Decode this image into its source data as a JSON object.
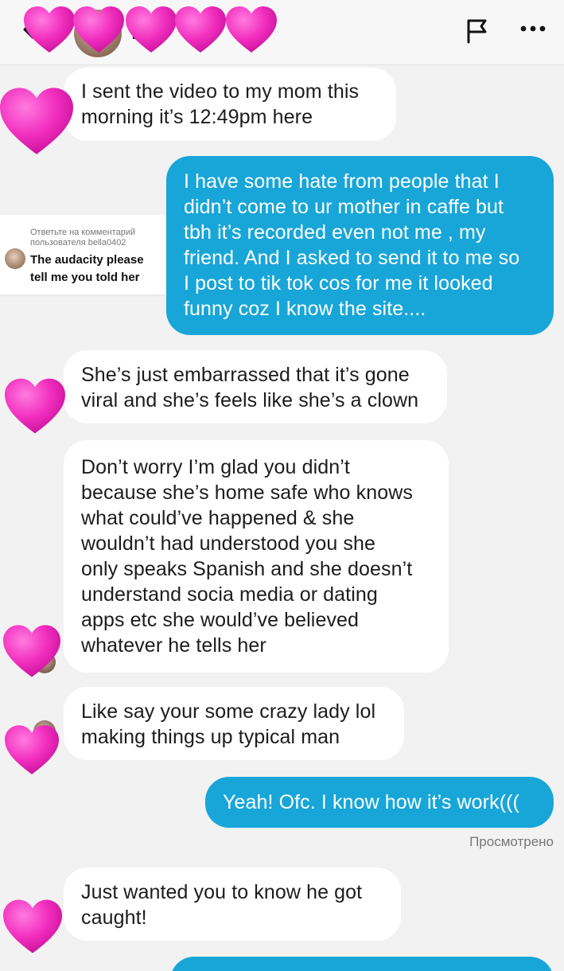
{
  "header": {
    "contact_name": "is",
    "icons": {
      "back": "chevron-left-icon",
      "flag": "flag-icon",
      "more": "more-horizontal-icon"
    }
  },
  "reply_card": {
    "title_line1": "Ответьте на комментарий",
    "title_line2": "пользователя bella0402",
    "text_line1": "The audacity please",
    "text_line2": "tell me you told her"
  },
  "messages": [
    {
      "direction": "incoming",
      "lines": [
        "I sent the video to my mom this",
        "morning it’s 12:49pm here"
      ]
    },
    {
      "direction": "outgoing",
      "lines": [
        "I have some hate from people that I",
        "didn’t come to ur mother in caffe but",
        "tbh it’s recorded even not me , my",
        "friend. And I asked to send it to me so",
        "I post to tik tok cos for me it looked",
        "funny coz I know the site...."
      ]
    },
    {
      "direction": "incoming",
      "lines": [
        "She’s just embarrassed that it’s gone",
        "viral and she’s feels like she’s a clown"
      ]
    },
    {
      "direction": "incoming",
      "lines": [
        "Don’t worry I’m glad you didn’t",
        "because she’s home safe who knows",
        "what could’ve happened & she",
        "wouldn’t had understood you she",
        "only speaks Spanish and she doesn’t",
        "understand socia media or dating",
        "apps etc she would’ve believed",
        "whatever he tells her"
      ]
    },
    {
      "direction": "incoming",
      "lines": [
        "Like say your some crazy lady lol",
        "making things up typical man"
      ]
    },
    {
      "direction": "outgoing",
      "lines": [
        "Yeah! Ofc. I know how it’s work((("
      ]
    },
    {
      "direction": "incoming",
      "lines": [
        "Just wanted you to know he got",
        "caught!"
      ]
    }
  ],
  "seen_label": "Просмотрено",
  "colors": {
    "outgoing_bubble": "#18a6d8",
    "incoming_bubble": "#ffffff",
    "background": "#f2f2f2",
    "heart": "#f026b8"
  }
}
